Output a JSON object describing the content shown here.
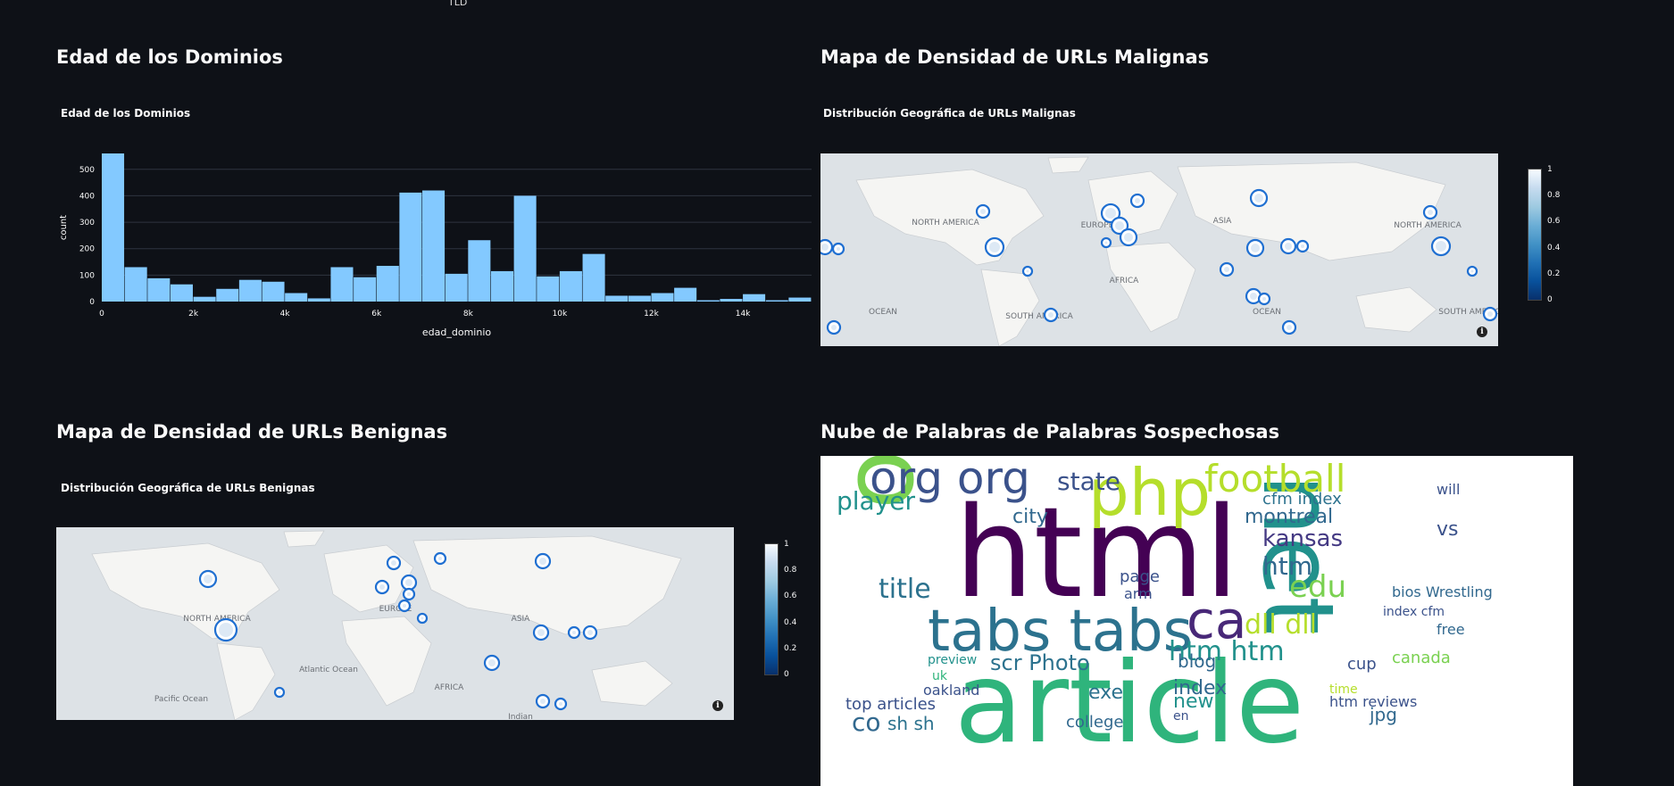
{
  "top_fragment": "TLD",
  "sections": {
    "age": {
      "title": "Edad de los Dominios",
      "chart_title": "Edad de los Dominios"
    },
    "malignant_map": {
      "title": "Mapa de Densidad de URLs Malignas",
      "chart_title": "Distribución Geográfica de URLs Malignas"
    },
    "benign_map": {
      "title": "Mapa de Densidad de URLs Benignas",
      "chart_title": "Distribución Geográfica de URLs Benignas"
    },
    "wordcloud": {
      "title": "Nube de Palabras de Palabras Sospechosas"
    }
  },
  "chart_data": {
    "type": "bar",
    "title": "Edad de los Dominios",
    "xlabel": "edad_dominio",
    "ylabel": "count",
    "bin_width": 500,
    "x_start": 0,
    "xlim": [
      0,
      15500
    ],
    "ylim": [
      0,
      560
    ],
    "x_ticks": [
      0,
      2000,
      4000,
      6000,
      8000,
      10000,
      12000,
      14000
    ],
    "x_tick_labels": [
      "0",
      "2k",
      "4k",
      "6k",
      "8k",
      "10k",
      "12k",
      "14k"
    ],
    "y_ticks": [
      0,
      100,
      200,
      300,
      400,
      500
    ],
    "values": [
      560,
      130,
      88,
      65,
      18,
      48,
      82,
      75,
      32,
      12,
      130,
      92,
      135,
      412,
      420,
      105,
      232,
      115,
      400,
      95,
      115,
      180,
      22,
      22,
      32,
      52,
      5,
      10,
      28,
      5,
      15
    ],
    "color": "#83c9ff",
    "grid": true
  },
  "colorbar": {
    "ticks": [
      "1",
      "0.8",
      "0.6",
      "0.4",
      "0.2",
      "0"
    ]
  },
  "map_labels": {
    "malignant": [
      "NORTH AMERICA",
      "EUROPE",
      "ASIA",
      "AFRICA",
      "SOUTH AMERICA",
      "OCEAN",
      "OCEAN",
      "NORTH AMERICA",
      "SOUTH AMERICA"
    ],
    "benign": [
      "NORTH AMERICA",
      "EUROPE",
      "ASIA",
      "AFRICA",
      "Atlantic Ocean",
      "Pacific Ocean",
      "Indian"
    ]
  },
  "map_info_icon": "info-icon",
  "wordcloud_words": [
    {
      "t": "html",
      "s": 140,
      "c": "#440154",
      "x": 150,
      "y": 40
    },
    {
      "t": "article",
      "s": 125,
      "c": "#2fb47c",
      "x": 150,
      "y": 215
    },
    {
      "t": "org",
      "s": 110,
      "c": "#7ad151",
      "x": 10,
      "y": 60,
      "r": -90
    },
    {
      "t": "net",
      "s": 110,
      "c": "#21918c",
      "x": 590,
      "y": 20,
      "r": 90
    },
    {
      "t": "tabs tabs",
      "s": 64,
      "c": "#2c728e",
      "x": 120,
      "y": 165
    },
    {
      "t": "php",
      "s": 72,
      "c": "#b5de2b",
      "x": 300,
      "y": 5
    },
    {
      "t": "org org",
      "s": 50,
      "c": "#3b528b",
      "x": 55,
      "y": 0
    },
    {
      "t": "football",
      "s": 42,
      "c": "#b5de2b",
      "x": 430,
      "y": 5
    },
    {
      "t": "ca",
      "s": 58,
      "c": "#482878",
      "x": 410,
      "y": 155
    },
    {
      "t": "state",
      "s": 28,
      "c": "#3b528b",
      "x": 265,
      "y": 15
    },
    {
      "t": "player",
      "s": 28,
      "c": "#21918c",
      "x": 18,
      "y": 37
    },
    {
      "t": "city",
      "s": 22,
      "c": "#31688e",
      "x": 215,
      "y": 58
    },
    {
      "t": "montreal",
      "s": 22,
      "c": "#31688e",
      "x": 475,
      "y": 58
    },
    {
      "t": "kansas",
      "s": 26,
      "c": "#443983",
      "x": 495,
      "y": 80
    },
    {
      "t": "cfm index",
      "s": 18,
      "c": "#2c728e",
      "x": 495,
      "y": 40
    },
    {
      "t": "htm",
      "s": 28,
      "c": "#31688e",
      "x": 495,
      "y": 110
    },
    {
      "t": "edu",
      "s": 34,
      "c": "#7ad151",
      "x": 525,
      "y": 130
    },
    {
      "t": "title",
      "s": 30,
      "c": "#2c728e",
      "x": 65,
      "y": 135
    },
    {
      "t": "dll dll",
      "s": 30,
      "c": "#b5de2b",
      "x": 475,
      "y": 175
    },
    {
      "t": "htm htm",
      "s": 30,
      "c": "#21918c",
      "x": 390,
      "y": 205
    },
    {
      "t": "scr Photo",
      "s": 24,
      "c": "#2c728e",
      "x": 190,
      "y": 220
    },
    {
      "t": "blog",
      "s": 20,
      "c": "#31688e",
      "x": 400,
      "y": 220
    },
    {
      "t": "index",
      "s": 22,
      "c": "#31688e",
      "x": 395,
      "y": 250
    },
    {
      "t": "new",
      "s": 22,
      "c": "#21918c",
      "x": 395,
      "y": 265
    },
    {
      "t": "exe",
      "s": 22,
      "c": "#2c728e",
      "x": 300,
      "y": 255
    },
    {
      "t": "oakland",
      "s": 16,
      "c": "#3b528b",
      "x": 115,
      "y": 255
    },
    {
      "t": "top articles",
      "s": 18,
      "c": "#3b528b",
      "x": 28,
      "y": 270
    },
    {
      "t": "co",
      "s": 28,
      "c": "#31688e",
      "x": 35,
      "y": 285
    },
    {
      "t": "sh sh",
      "s": 20,
      "c": "#2c728e",
      "x": 75,
      "y": 290
    },
    {
      "t": "college",
      "s": 18,
      "c": "#31688e",
      "x": 275,
      "y": 290
    },
    {
      "t": "htm reviews",
      "s": 16,
      "c": "#3b528b",
      "x": 570,
      "y": 268
    },
    {
      "t": "jpg",
      "s": 20,
      "c": "#31688e",
      "x": 615,
      "y": 280
    },
    {
      "t": "bios Wrestling",
      "s": 16,
      "c": "#31688e",
      "x": 640,
      "y": 145
    },
    {
      "t": "canada",
      "s": 18,
      "c": "#7ad151",
      "x": 640,
      "y": 218
    },
    {
      "t": "free",
      "s": 16,
      "c": "#31688e",
      "x": 690,
      "y": 187
    },
    {
      "t": "vs",
      "s": 22,
      "c": "#3b528b",
      "x": 690,
      "y": 72
    },
    {
      "t": "will",
      "s": 16,
      "c": "#3b528b",
      "x": 690,
      "y": 30
    },
    {
      "t": "index cfm",
      "s": 14,
      "c": "#3b528b",
      "x": 630,
      "y": 168
    },
    {
      "t": "page",
      "s": 18,
      "c": "#3b528b",
      "x": 335,
      "y": 127
    },
    {
      "t": "arm",
      "s": 16,
      "c": "#3b528b",
      "x": 340,
      "y": 147
    },
    {
      "t": "preview",
      "s": 14,
      "c": "#21918c",
      "x": 120,
      "y": 222
    },
    {
      "t": "time",
      "s": 14,
      "c": "#b5de2b",
      "x": 570,
      "y": 255
    },
    {
      "t": "cup",
      "s": 18,
      "c": "#3b528b",
      "x": 590,
      "y": 225
    },
    {
      "t": "uk",
      "s": 14,
      "c": "#2fb47c",
      "x": 125,
      "y": 240
    },
    {
      "t": "en",
      "s": 14,
      "c": "#3b528b",
      "x": 395,
      "y": 285
    }
  ]
}
